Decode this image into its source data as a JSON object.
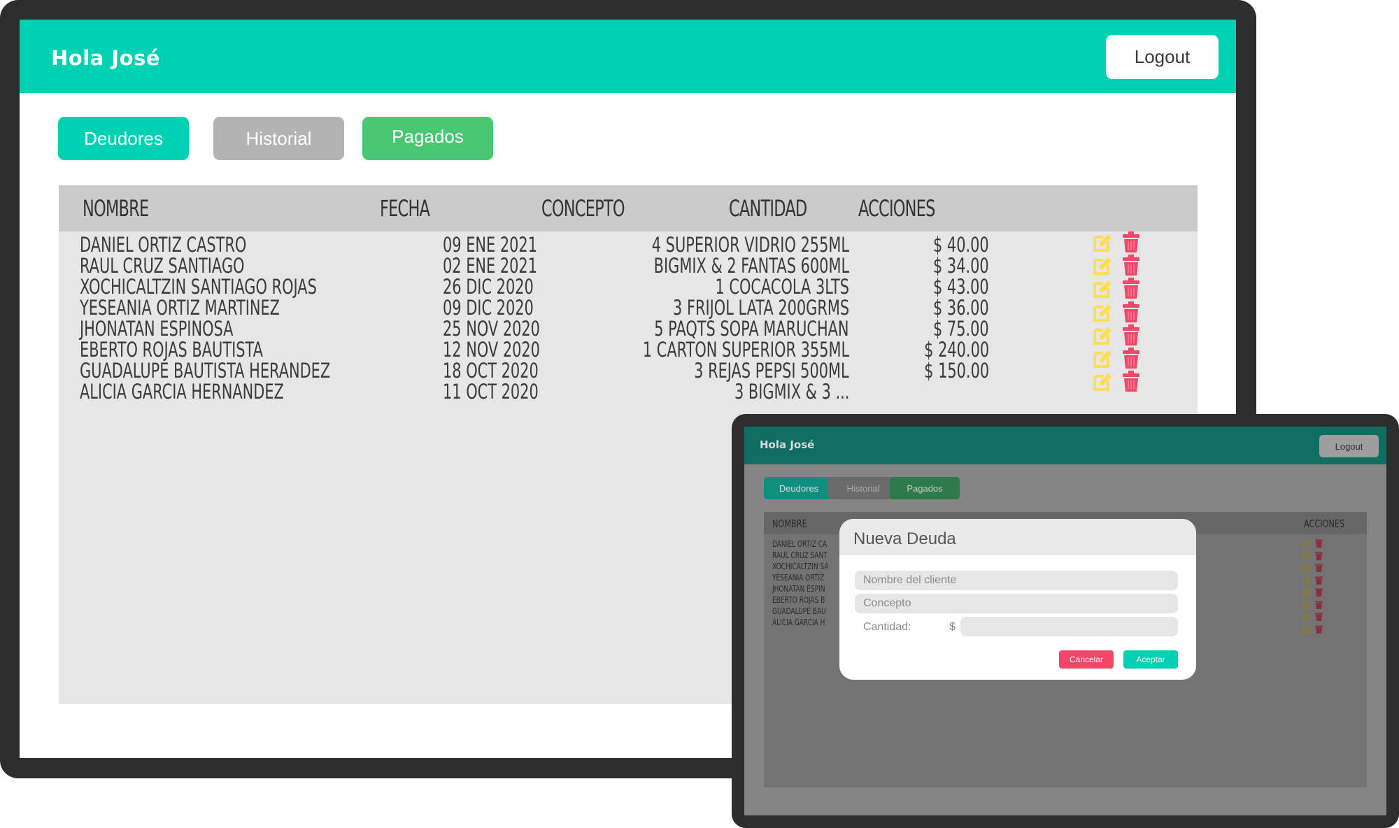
{
  "app": {
    "greeting": "Hola José",
    "logout_label": "Logout"
  },
  "tabs": {
    "deudores": "Deudores",
    "historial": "Historial",
    "pagados": "Pagados"
  },
  "table": {
    "headers": {
      "nombre": "NOMBRE",
      "fecha": "FECHA",
      "concepto": "CONCEPTO",
      "cantidad": "CANTIDAD",
      "acciones": "ACCIONES"
    },
    "rows": [
      {
        "nombre": "DANIEL ORTIZ CASTRO",
        "fecha": "09 ENE 2021",
        "concepto": "4 SUPERIOR VIDRIO 255ML",
        "cantidad": "$ 40.00"
      },
      {
        "nombre": "RAUL CRUZ SANTIAGO",
        "fecha": "02 ENE 2021",
        "concepto": "BIGMIX & 2 FANTAS 600ML",
        "cantidad": "$ 34.00"
      },
      {
        "nombre": "XOCHICALTZIN SANTIAGO ROJAS",
        "fecha": "26 DIC 2020",
        "concepto": "1 COCACOLA 3LTS",
        "cantidad": "$ 43.00"
      },
      {
        "nombre": "YESEANIA ORTIZ MARTINEZ",
        "fecha": "09 DIC 2020",
        "concepto": "3 FRIJOL LATA 200GRMS",
        "cantidad": "$ 36.00"
      },
      {
        "nombre": "JHONATAN ESPINOSA",
        "fecha": "25 NOV 2020",
        "concepto": "5 PAQTS SOPA MARUCHAN",
        "cantidad": "$ 75.00"
      },
      {
        "nombre": "EBERTO ROJAS BAUTISTA",
        "fecha": "12 NOV 2020",
        "concepto": "1 CARTON SUPERIOR 355ML",
        "cantidad": "$ 240.00"
      },
      {
        "nombre": "GUADALUPE BAUTISTA HERANDEZ",
        "fecha": "18 OCT 2020",
        "concepto": "3 REJAS PEPSI 500ML",
        "cantidad": "$ 150.00"
      },
      {
        "nombre": "ALICIA GARCIA HERNANDEZ",
        "fecha": "11 OCT 2020",
        "concepto": "3 BIGMIX & 3 ...",
        "cantidad": ""
      }
    ],
    "mini_rows": [
      "DANIEL ORTIZ CA",
      "RAUL CRUZ SANT",
      "XOCHICALTZIN SA",
      "YESEANIA ORTIZ",
      "JHONATAN ESPIN",
      "EBERTO ROJAS B",
      "GUADALUPE BAU",
      "ALICIA GARCIA H"
    ]
  },
  "modal": {
    "title": "Nueva Deuda",
    "nombre_placeholder": "Nombre del cliente",
    "concepto_placeholder": "Concepto",
    "cantidad_label": "Cantidad:",
    "currency_symbol": "$",
    "cancel_label": "Cancelar",
    "accept_label": "Aceptar"
  },
  "colors": {
    "header": "#00d1b2",
    "deudores": "#00d1b2",
    "historial": "#b3b3b3",
    "pagados": "#48c774",
    "edit_icon": "#ffdd57",
    "trash_icon": "#f14668",
    "cancel": "#f14668",
    "accept": "#00d1b2"
  },
  "icons": {
    "edit": "edit-icon",
    "delete": "trash-icon"
  }
}
